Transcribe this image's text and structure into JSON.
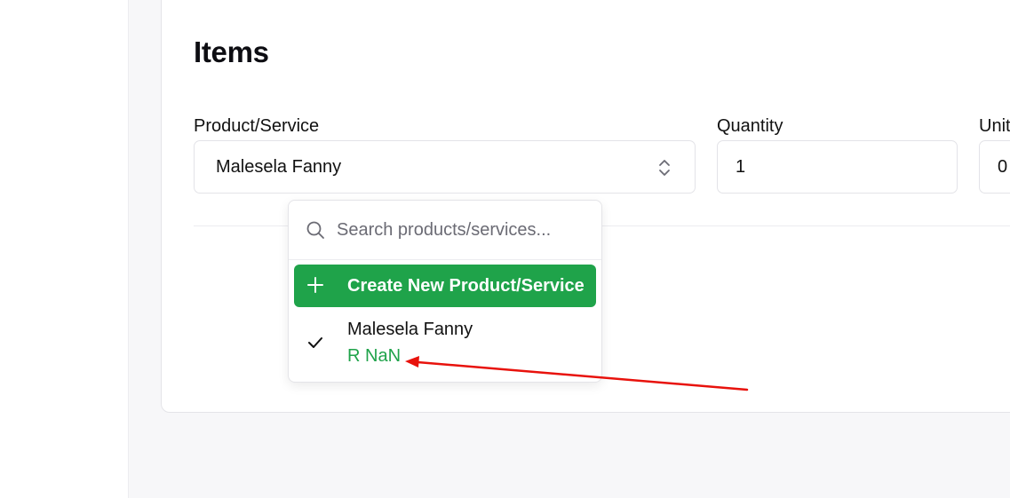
{
  "section": {
    "title": "Items"
  },
  "fields": {
    "product_label": "Product/Service",
    "product_value": "Malesela Fanny",
    "quantity_label": "Quantity",
    "quantity_value": "1",
    "unit_label": "Unit",
    "unit_value": "0"
  },
  "dropdown": {
    "search_placeholder": "Search products/services...",
    "create_label": "Create New Product/Service",
    "options": [
      {
        "name": "Malesela Fanny",
        "price": "R NaN",
        "selected": true
      }
    ]
  },
  "icons": {
    "search": "search-icon",
    "plus": "plus-icon",
    "check": "check-icon",
    "chevrons": "chevron-up-down-icon"
  },
  "colors": {
    "accent_green": "#1fa34a",
    "annotation_red": "#e8120c"
  }
}
